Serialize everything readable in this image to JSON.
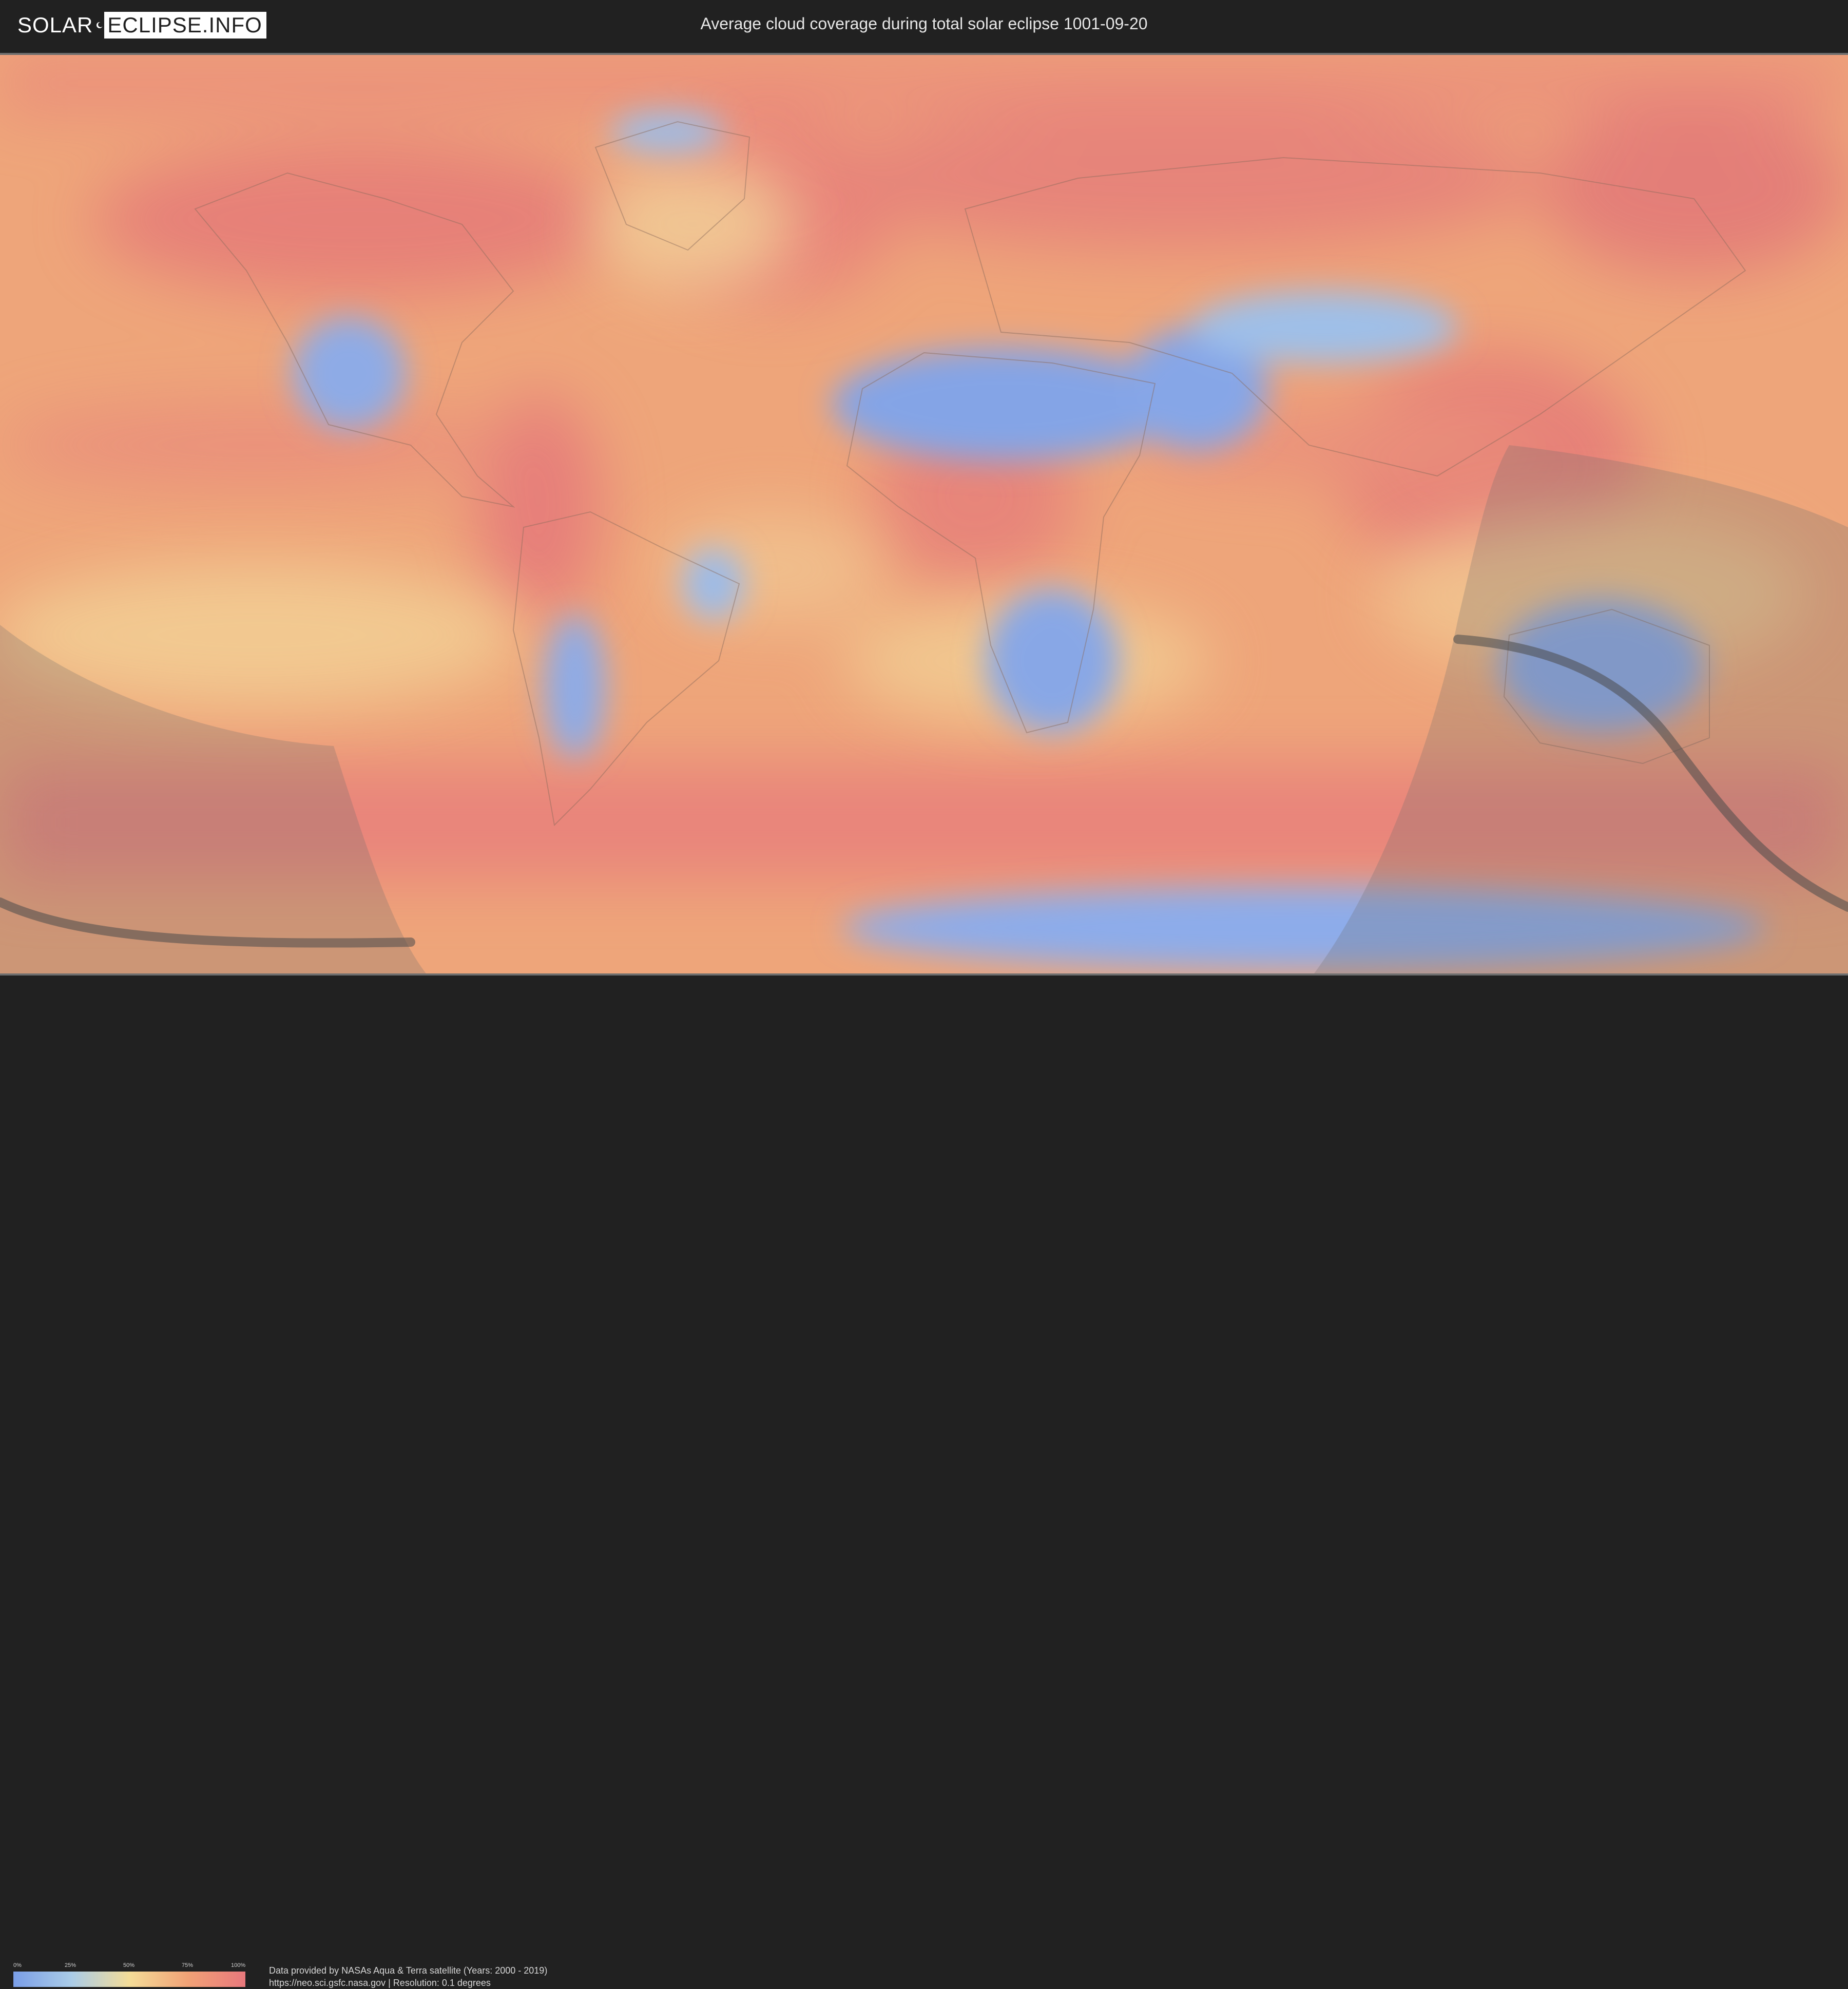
{
  "header": {
    "logo_left": "SOLAR",
    "logo_right": "ECLIPSE.INFO",
    "title": "Average cloud coverage during total solar eclipse 1001-09-20"
  },
  "legend": {
    "ticks": [
      "0%",
      "25%",
      "50%",
      "75%",
      "100%"
    ],
    "colors": [
      "#7a9ee8",
      "#aacce8",
      "#f4dc98",
      "#f1a276",
      "#e8787c"
    ]
  },
  "footer": {
    "credit_line1": "Data provided by NASAs Aqua & Terra satellite (Years: 2000 - 2019)",
    "credit_line2": "https://neo.sci.gsfc.nasa.gov | Resolution: 0.1 degrees"
  },
  "map": {
    "base_color": "#e9a877",
    "cloudy_color": "#e8787c",
    "clear_color": "#7a9ee8",
    "shadow_color": "#6b6b6b",
    "eclipse_path_color": "#4a4a4a"
  }
}
